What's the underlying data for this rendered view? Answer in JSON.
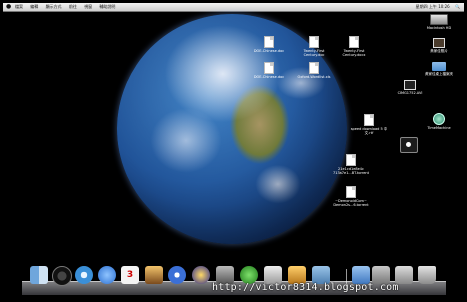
{
  "menubar": {
    "apple_icon": "apple-icon",
    "menus": [
      "檔案",
      "編輯",
      "顯示方式",
      "前往",
      "視窗",
      "輔助說明"
    ],
    "right": [
      "星期四 上午 10:26",
      "🔍"
    ]
  },
  "desktop": {
    "files": [
      {
        "label": "DOE-Chinese.doc"
      },
      {
        "label": "Twenty-First",
        "label2": "Century.doc"
      },
      {
        "label": "Twenty-First",
        "label2": "Century.docx"
      },
      {
        "label": "DOE-Chinese.doc"
      },
      {
        "label": "Oxford-Wordlist.xls"
      },
      {
        "label": "speed download 5 中",
        "label2": "文.rtf"
      },
      {
        "label": "21e1cd1e8e4c",
        "label2": "713a7e1...BT.torrent"
      },
      {
        "label": "~DemonoidCom~",
        "label2": "Demon2s...6.torrent"
      }
    ],
    "right_icons": [
      {
        "label": "Macintosh HD",
        "icon": "hard-drive-icon"
      },
      {
        "label": "黃家佳照片",
        "icon": "photo-icon"
      },
      {
        "label": "黃家佳桌上檔案夾",
        "icon": "folder-icon"
      },
      {
        "label": "CIMG1752.AVI",
        "icon": "video-file-icon"
      },
      {
        "label": "TimeMachine",
        "icon": "time-machine-icon"
      }
    ]
  },
  "dock": {
    "calendar_day": "3",
    "icons": [
      "finder-icon",
      "dashboard-icon",
      "safari-icon",
      "ichat-icon",
      "address-book-icon",
      "ical-icon",
      "iphoto-icon",
      "itunes-icon",
      "imovie-icon",
      "garageband-icon",
      "time-machine-icon",
      "preview-icon",
      "photo-booth-icon",
      "textedit-icon",
      "documents-folder-icon",
      "downloads-stack-icon",
      "desktop-stack-icon",
      "trash-icon"
    ]
  },
  "watermark": "http://victor8314.blogspot.com"
}
